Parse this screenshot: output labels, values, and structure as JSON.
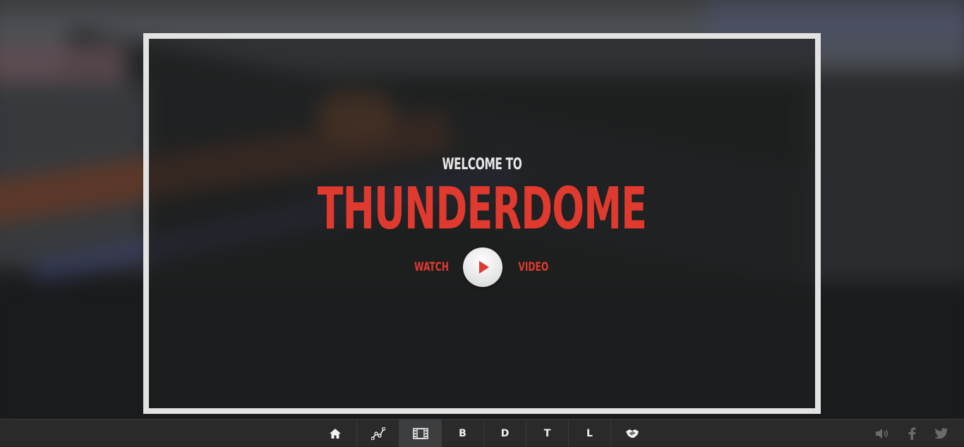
{
  "hero": {
    "welcome": "WELCOME TO",
    "title": "THUNDERDOME",
    "watch_label": "WATCH",
    "video_label": "VIDEO",
    "play_icon": "play-icon"
  },
  "nav": {
    "items": [
      {
        "icon": "home-icon",
        "label": ""
      },
      {
        "icon": "chart-line-icon",
        "label": ""
      },
      {
        "icon": "film-icon",
        "label": "",
        "active": true
      },
      {
        "icon": "",
        "label": "B"
      },
      {
        "icon": "",
        "label": "D"
      },
      {
        "icon": "",
        "label": "T"
      },
      {
        "icon": "",
        "label": "L"
      },
      {
        "icon": "handshake-icon",
        "label": ""
      }
    ]
  },
  "social": {
    "icons": [
      "volume-icon",
      "facebook-icon",
      "twitter-icon"
    ]
  },
  "colors": {
    "accent": "#e03a2f",
    "frame": "#e2e2e2",
    "navbar": "#2a2a2b"
  }
}
